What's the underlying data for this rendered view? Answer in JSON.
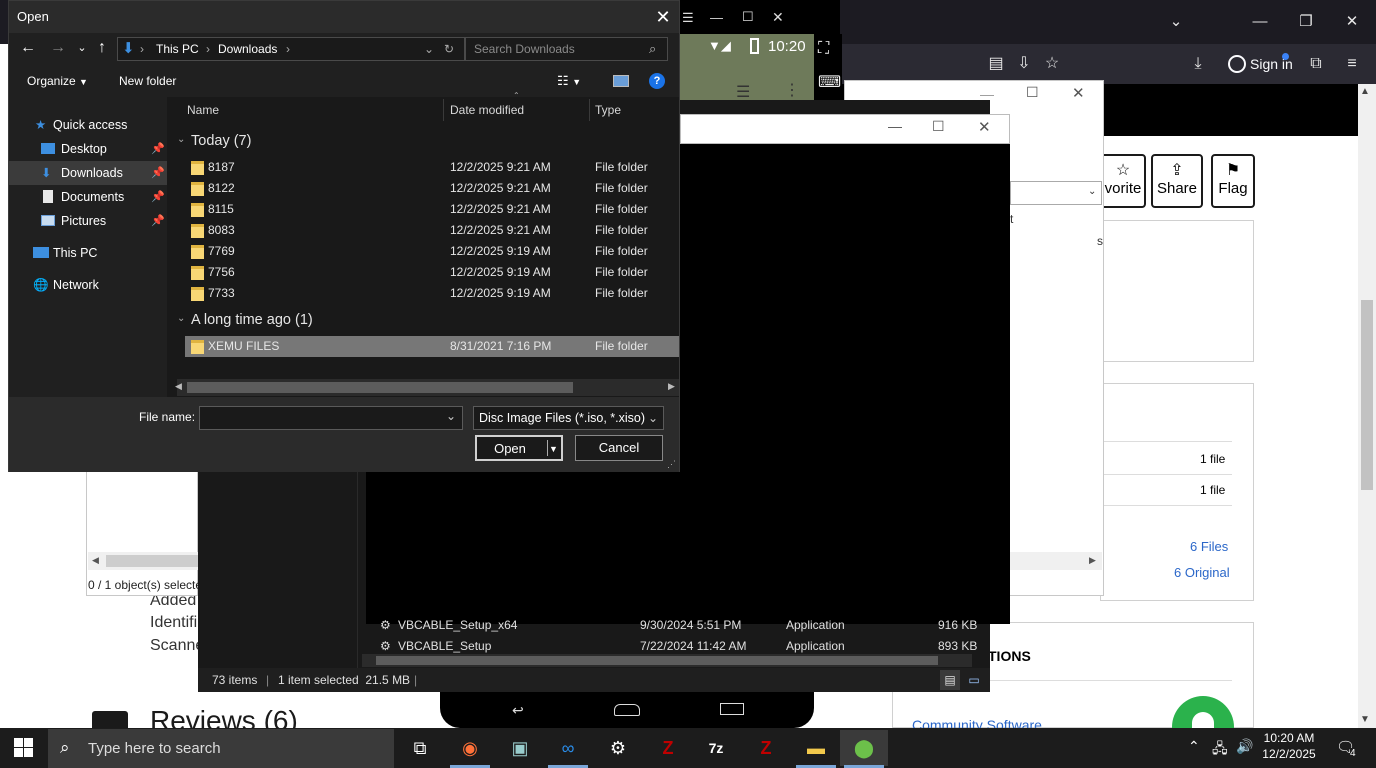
{
  "browser": {
    "sign_in_label": "Sign in",
    "action_buttons": [
      {
        "label": "vorite",
        "icon": "star-icon"
      },
      {
        "label": "Share",
        "icon": "share-icon"
      },
      {
        "label": "Flag",
        "icon": "flag-icon"
      }
    ],
    "file_counts": [
      "1 file",
      "1 file"
    ],
    "files_link": "6 Files",
    "original_link": "6 Original",
    "section_heading": "TIONS",
    "community_link": "Community Software",
    "left_snippets": [
      "Added",
      "Identifi",
      "Scanne"
    ],
    "reviews_heading": "Reviews (6)"
  },
  "emulator": {
    "clock": "10:20"
  },
  "small_window": {
    "status_text": "0 / 1 object(s) selecte"
  },
  "props_window": {
    "snippet_t": "t",
    "snippet_s": "s"
  },
  "explorer": {
    "rows": [
      {
        "name": "VBCABLE_Setup_x64",
        "date": "9/30/2024 5:51 PM",
        "type": "Application",
        "size": "916 KB"
      },
      {
        "name": "VBCABLE_Setup",
        "date": "7/22/2024 11:42 AM",
        "type": "Application",
        "size": "893 KB"
      }
    ],
    "status_items": "73 items",
    "status_selected": "1 item selected  21.5 MB"
  },
  "open_dialog": {
    "title": "Open",
    "breadcrumb": [
      "This PC",
      "Downloads"
    ],
    "search_placeholder": "Search Downloads",
    "organize_label": "Organize",
    "new_folder_label": "New folder",
    "nav": {
      "quick_access": "Quick access",
      "desktop": "Desktop",
      "downloads": "Downloads",
      "documents": "Documents",
      "pictures": "Pictures",
      "this_pc": "This PC",
      "network": "Network"
    },
    "columns": {
      "name": "Name",
      "date": "Date modified",
      "type": "Type"
    },
    "groups": [
      {
        "label": "Today (7)",
        "files": [
          {
            "name": "8187",
            "date": "12/2/2025 9:21 AM",
            "type": "File folder"
          },
          {
            "name": "8122",
            "date": "12/2/2025 9:21 AM",
            "type": "File folder"
          },
          {
            "name": "8115",
            "date": "12/2/2025 9:21 AM",
            "type": "File folder"
          },
          {
            "name": "8083",
            "date": "12/2/2025 9:21 AM",
            "type": "File folder"
          },
          {
            "name": "7769",
            "date": "12/2/2025 9:19 AM",
            "type": "File folder"
          },
          {
            "name": "7756",
            "date": "12/2/2025 9:19 AM",
            "type": "File folder"
          },
          {
            "name": "7733",
            "date": "12/2/2025 9:19 AM",
            "type": "File folder"
          }
        ]
      },
      {
        "label": "A long time ago (1)",
        "files": [
          {
            "name": "XEMU FILES",
            "date": "8/31/2021 7:16 PM",
            "type": "File folder",
            "selected": true
          }
        ]
      }
    ],
    "file_name_label": "File name:",
    "file_name_value": "",
    "file_type_value": "Disc Image Files (*.iso, *.xiso)",
    "open_label": "Open",
    "cancel_label": "Cancel"
  },
  "taskbar": {
    "search_placeholder": "Type here to search",
    "time": "10:20 AM",
    "date": "12/2/2025",
    "notification_count": "4"
  },
  "colors": {
    "dialog_bg": "#202020",
    "selected_row": "#777777",
    "taskbar": "#1c1c1c",
    "link": "#2b67c9"
  }
}
